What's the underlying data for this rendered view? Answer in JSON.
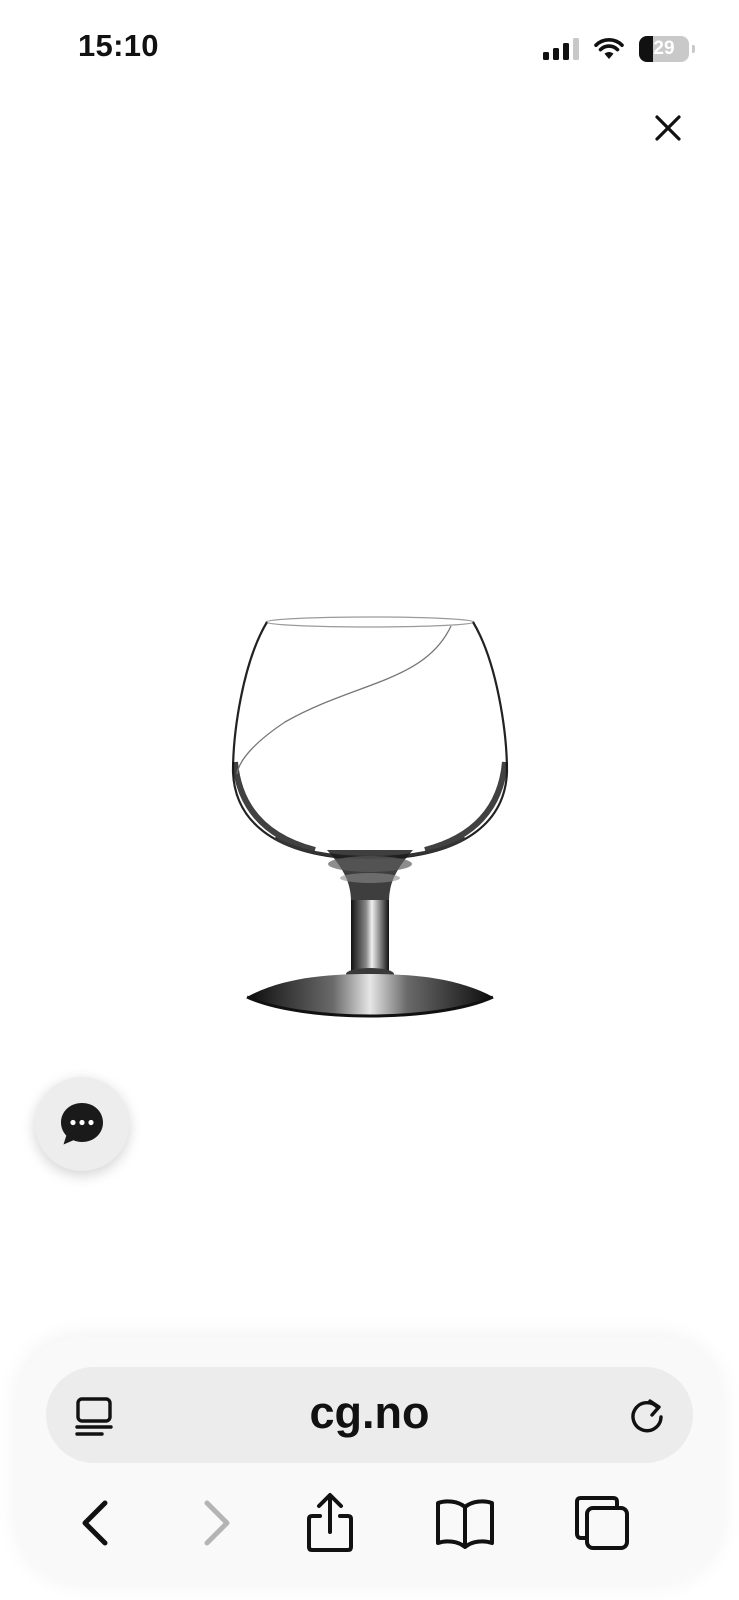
{
  "status_bar": {
    "time": "15:10",
    "signal_icon": "cellular-signal-icon",
    "wifi_icon": "wifi-icon",
    "battery_percent": "29",
    "battery_level": 0.29
  },
  "viewer": {
    "close_icon": "close-icon",
    "image_subject": "brandy-glass-product-image"
  },
  "chat": {
    "icon": "chat-bubble-icon"
  },
  "browser": {
    "url": "cg.no",
    "page_menu_icon": "page-menu-icon",
    "reload_icon": "reload-icon",
    "nav": {
      "back_icon": "back-icon",
      "forward_icon": "forward-icon",
      "share_icon": "share-icon",
      "bookmarks_icon": "bookmarks-icon",
      "tabs_icon": "tabs-icon"
    },
    "colors": {
      "toolbar_bg": "#f9f9f9",
      "address_bg": "#ececec",
      "disabled": "#b4b4b4"
    }
  }
}
